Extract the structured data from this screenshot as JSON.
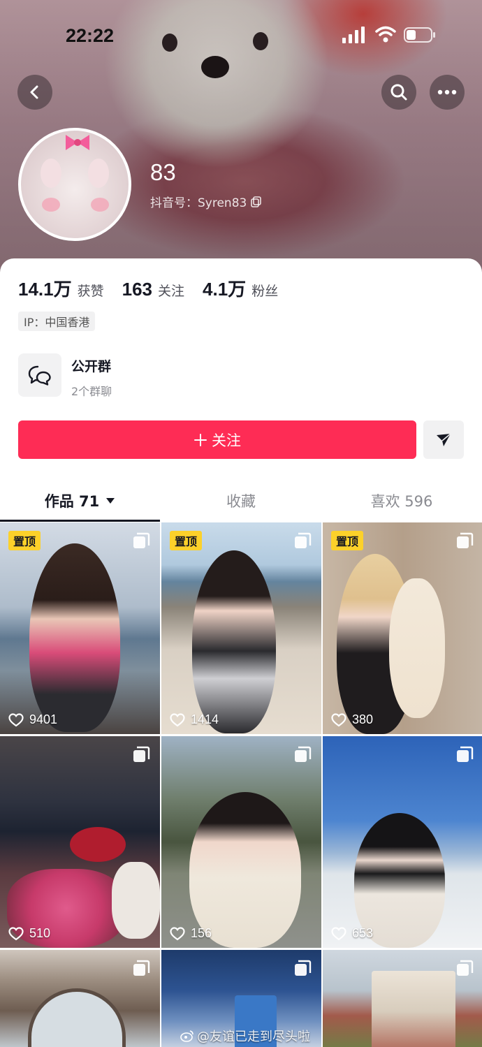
{
  "status_bar": {
    "time": "22:22"
  },
  "profile": {
    "nickname": "83",
    "douyin_id_label": "抖音号：Syren83"
  },
  "stats": [
    {
      "value": "14.1万",
      "label": "获赞"
    },
    {
      "value": "163",
      "label": "关注"
    },
    {
      "value": "4.1万",
      "label": "粉丝"
    }
  ],
  "ip_label": "IP：中国香港",
  "group": {
    "title": "公开群",
    "subtitle": "2个群聊"
  },
  "follow_label": "关注",
  "tabs": [
    {
      "label": "作品 71",
      "active": true
    },
    {
      "label": "收藏",
      "active": false
    },
    {
      "label": "喜欢 596",
      "active": false
    }
  ],
  "grid": [
    {
      "pinned": true,
      "pin_label": "置顶",
      "likes": "9401"
    },
    {
      "pinned": true,
      "pin_label": "置顶",
      "likes": "1414"
    },
    {
      "pinned": true,
      "pin_label": "置顶",
      "likes": "380"
    },
    {
      "pinned": false,
      "likes": "510"
    },
    {
      "pinned": false,
      "likes": "156"
    },
    {
      "pinned": false,
      "likes": "653"
    },
    {
      "pinned": false,
      "likes": ""
    },
    {
      "pinned": false,
      "likes": ""
    },
    {
      "pinned": false,
      "likes": ""
    }
  ],
  "watermark": "@友谊已走到尽头啦",
  "colors": {
    "accent": "#fe2c55",
    "pin": "#fcd12a"
  }
}
